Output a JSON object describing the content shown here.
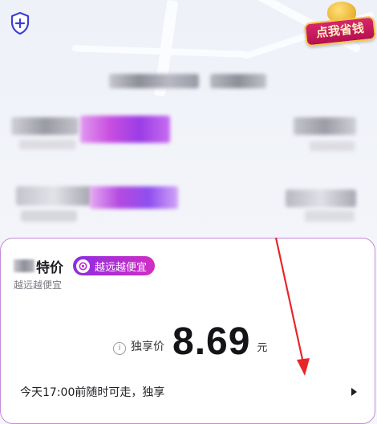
{
  "header": {
    "badge_text": "点我省钱"
  },
  "card": {
    "title": "特价",
    "tag_label": "越远越便宜",
    "subtitle": "越远越便宜",
    "price_label": "独享价",
    "price_value": "8.69",
    "price_unit": "元",
    "info_icon": "i",
    "footer_text": "今天17:00前随时可走，独享"
  },
  "colors": {
    "accent_purple": "#8d2de2",
    "accent_magenta": "#d12ec4",
    "card_border": "#c58ad8",
    "annotation_red": "#e8262a"
  },
  "icons": [
    "shield-plus-icon",
    "save-money-badge",
    "tag-coin-icon",
    "info-icon",
    "chevron-right-icon"
  ]
}
